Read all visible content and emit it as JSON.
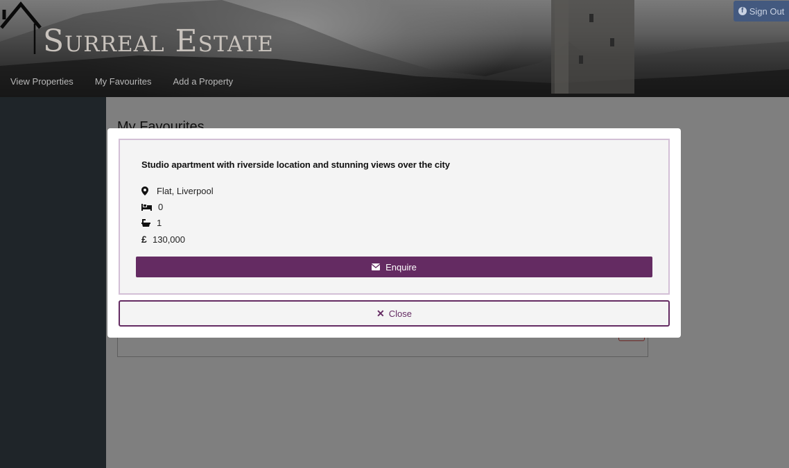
{
  "header": {
    "site_title": "Surreal Estate",
    "signout_label": "Sign Out"
  },
  "nav": {
    "items": [
      {
        "label": "View Properties"
      },
      {
        "label": "My Favourites"
      },
      {
        "label": "Add a Property"
      }
    ]
  },
  "page": {
    "heading": "My Favourites"
  },
  "modal": {
    "title": "Studio apartment with riverside location and stunning views over the city",
    "location": "Flat, Liverpool",
    "bedrooms": "0",
    "bathrooms": "1",
    "price": "130,000",
    "currency_symbol": "£",
    "enquire_label": "Enquire",
    "close_label": "Close",
    "close_symbol": "✕"
  },
  "colors": {
    "accent": "#642b62",
    "signout_bg": "#43597f",
    "sidebar": "#3f4a52"
  },
  "icons": {
    "location": "map-marker-icon",
    "bedrooms": "bed-icon",
    "bathrooms": "bath-icon",
    "price": "pound-icon",
    "enquire": "envelope-icon",
    "close": "close-icon",
    "signout": "facebook-icon"
  }
}
